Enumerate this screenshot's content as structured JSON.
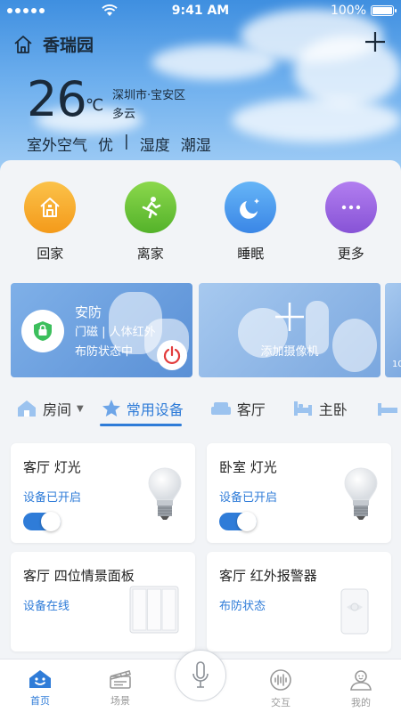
{
  "status_bar": {
    "time": "9:41 AM",
    "battery": "100%"
  },
  "header": {
    "home_name": "香瑞园",
    "temperature": "26",
    "temp_unit": "℃",
    "location": "深圳市·宝安区",
    "weather": "多云",
    "air_label": "室外空气",
    "air_value": "优",
    "separator": "|",
    "humidity_label": "湿度",
    "humidity_value": "潮湿"
  },
  "scenes": [
    {
      "label": "回家",
      "icon": "home-icon",
      "color": "#f7a928"
    },
    {
      "label": "离家",
      "icon": "running-person-icon",
      "color": "#6cc33a"
    },
    {
      "label": "睡眠",
      "icon": "moon-icon",
      "color": "#4a9cf0"
    },
    {
      "label": "更多",
      "icon": "more-dots-icon",
      "color": "#9a63dd"
    }
  ],
  "banners": {
    "security": {
      "title": "安防",
      "sub": "门磁 | 人体红外",
      "status": "布防状态中"
    },
    "camera": {
      "label": "添加摄像机"
    },
    "third": {
      "label": "10"
    }
  },
  "tabs": [
    {
      "label": "房间",
      "icon": "house-icon"
    },
    {
      "label": "常用设备",
      "icon": "star-icon"
    },
    {
      "label": "客厅",
      "icon": "sofa-icon"
    },
    {
      "label": "主卧",
      "icon": "bed-icon"
    }
  ],
  "devices": [
    {
      "title": "客厅 灯光",
      "status": "设备已开启",
      "toggle": true,
      "icon": "light-bulb-icon"
    },
    {
      "title": "卧室 灯光",
      "status": "设备已开启",
      "toggle": true,
      "icon": "light-bulb-icon"
    },
    {
      "title": "客厅 四位情景面板",
      "status": "设备在线",
      "icon": "switch-panel-icon"
    },
    {
      "title": "客厅 红外报警器",
      "status": "布防状态",
      "icon": "infrared-sensor-icon"
    }
  ],
  "bottom_nav": [
    {
      "label": "首页",
      "icon": "home-smile-icon",
      "active": true
    },
    {
      "label": "场景",
      "icon": "clapperboard-icon"
    },
    {
      "label": "交互",
      "icon": "voice-wave-icon"
    },
    {
      "label": "我的",
      "icon": "profile-icon"
    }
  ],
  "colors": {
    "accent": "#2f7cd8"
  }
}
